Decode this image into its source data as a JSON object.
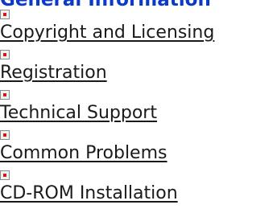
{
  "heading": "General Information",
  "topics": [
    {
      "label": "Copyright and Licensing",
      "icon": "topic-bullet-icon"
    },
    {
      "label": "Registration",
      "icon": "topic-bullet-icon"
    },
    {
      "label": "Technical Support",
      "icon": "topic-bullet-icon"
    },
    {
      "label": "Common Problems",
      "icon": "topic-bullet-icon"
    },
    {
      "label": "CD-ROM Installation",
      "icon": "topic-bullet-icon"
    }
  ],
  "colors": {
    "heading": "#0a3ac8",
    "link": "#1a1a1a",
    "bullet_mark": "#d01818"
  }
}
